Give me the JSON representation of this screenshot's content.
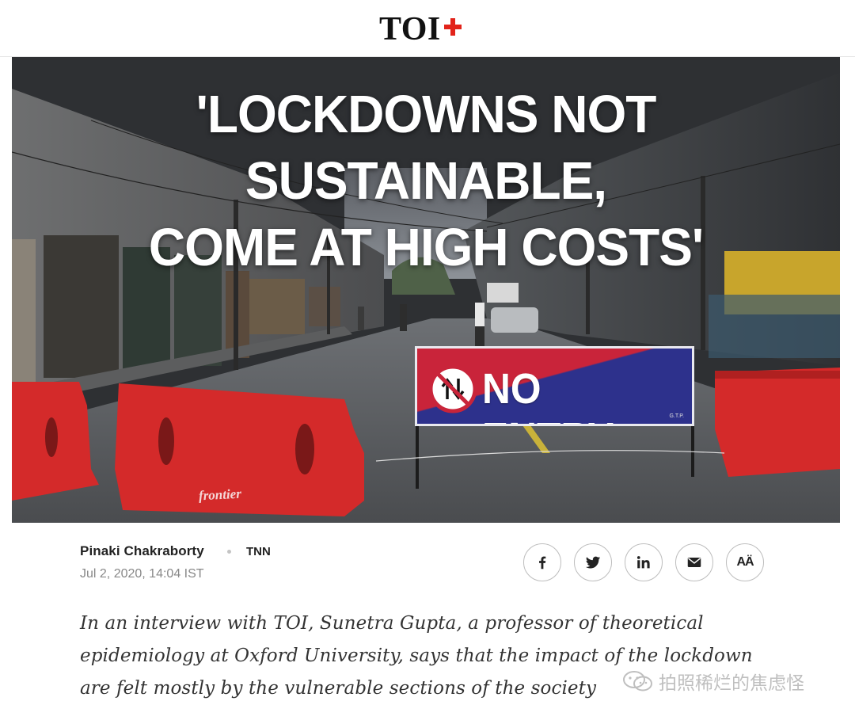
{
  "header": {
    "logo_text": "TOI",
    "logo_badge": "+"
  },
  "hero": {
    "headline_lines": [
      "'LOCKDOWNS NOT SUSTAINABLE,",
      "COME AT HIGH COSTS'"
    ],
    "sign_text": "NO ENTRY",
    "sign_small_text": "G.T.P.",
    "barrier_brand": "frontier"
  },
  "byline": {
    "author": "Pinaki Chakraborty",
    "source": "TNN",
    "date": "Jul 2, 2020, 14:04 IST"
  },
  "share": {
    "buttons": [
      {
        "icon": "facebook-icon"
      },
      {
        "icon": "twitter-icon"
      },
      {
        "icon": "linkedin-icon"
      },
      {
        "icon": "mail-icon"
      },
      {
        "icon": "font-size-icon",
        "label": "AÄ"
      }
    ]
  },
  "synopsis": {
    "lines": [
      "In an interview with TOI, Sunetra Gupta, a professor of theoretical",
      "epidemiology at Oxford University, says that the impact of the lockdown",
      "are felt mostly by the vulnerable sections of the society"
    ]
  },
  "watermark": {
    "text": "拍照稀烂的焦虑怪"
  },
  "colors": {
    "brand_red": "#e2231a",
    "sign_red": "#c9243a",
    "sign_blue": "#2d318c",
    "barrier_red": "#d42a2a",
    "text_muted": "#888888"
  }
}
